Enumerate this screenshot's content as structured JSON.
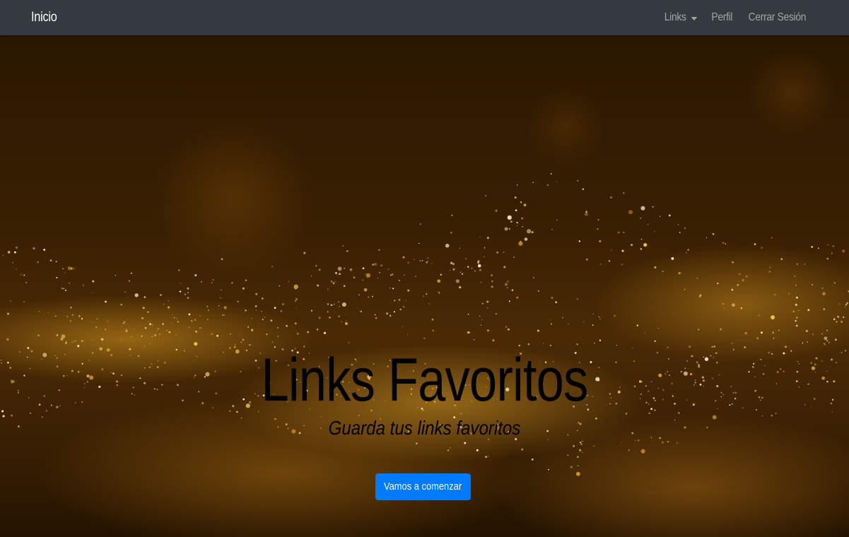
{
  "navbar": {
    "brand": "Inicio",
    "links_label": "Links",
    "profile_label": "Perfil",
    "logout_label": "Cerrar Sesión",
    "background": "#343a40"
  },
  "hero": {
    "title": "Links Favoritos",
    "subtitle": "Guarda tus links favoritos",
    "cta_label": "Vamos a comenzar",
    "cta_color": "#007bff",
    "background_description_colors": [
      "#2a1700",
      "#d29a1e"
    ]
  },
  "icons": {
    "dropdown_caret": "chevron-down-icon"
  }
}
